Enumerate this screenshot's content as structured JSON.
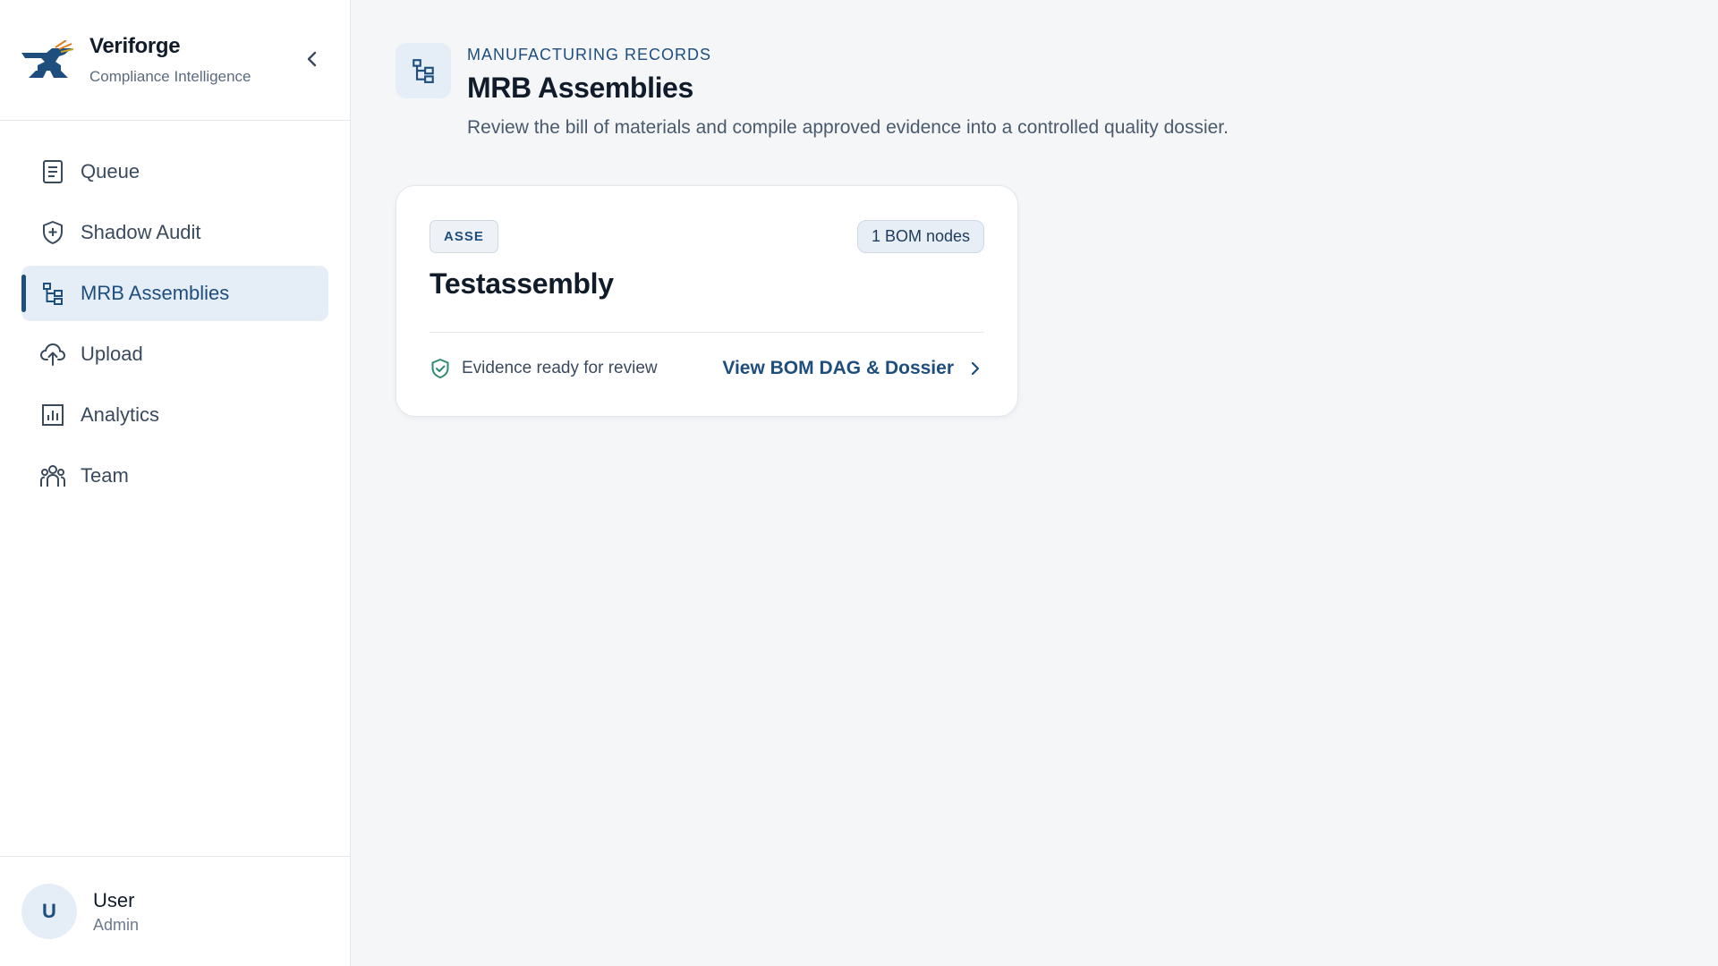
{
  "brand": {
    "name": "Veriforge",
    "subtitle": "Compliance Intelligence"
  },
  "sidebar": {
    "items": [
      {
        "label": "Queue",
        "icon": "document-list-icon"
      },
      {
        "label": "Shadow Audit",
        "icon": "shield-plus-icon"
      },
      {
        "label": "MRB Assemblies",
        "icon": "hierarchy-icon",
        "active": true
      },
      {
        "label": "Upload",
        "icon": "cloud-upload-icon"
      },
      {
        "label": "Analytics",
        "icon": "bar-chart-icon"
      },
      {
        "label": "Team",
        "icon": "users-icon"
      }
    ]
  },
  "user": {
    "initial": "U",
    "name": "User",
    "role": "Admin"
  },
  "header": {
    "eyebrow": "MANUFACTURING RECORDS",
    "title": "MRB Assemblies",
    "description": "Review the bill of materials and compile approved evidence into a controlled quality dossier."
  },
  "card": {
    "tag": "ASSE",
    "bom_nodes": "1 BOM nodes",
    "title": "Testassembly",
    "status": "Evidence ready for review",
    "link": "View BOM DAG & Dossier"
  },
  "colors": {
    "accent": "#1d4e7e",
    "active_bg": "#e5edf6",
    "status_green": "#2f8a74"
  }
}
